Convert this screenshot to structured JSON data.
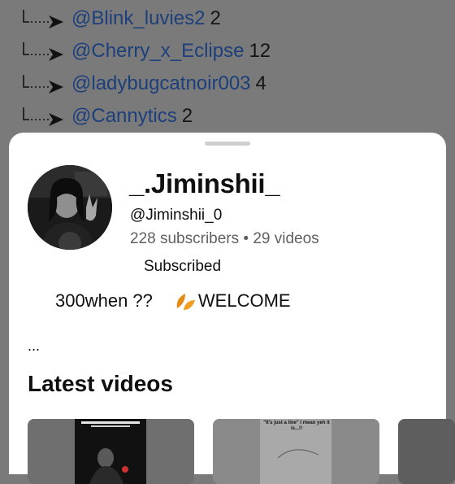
{
  "background_list": [
    {
      "handle": "@Blink_luvies2",
      "count": "2"
    },
    {
      "handle": "@Cherry_x_Eclipse",
      "count": "12"
    },
    {
      "handle": "@ladybugcatnoir003",
      "count": "4"
    },
    {
      "handle": "@Cannytics",
      "count": "2"
    }
  ],
  "channel": {
    "name": "_.Jiminshii_",
    "handle": "@Jiminshii_0",
    "stats": "228 subscribers • 29 videos",
    "subscribe_label": "Subscribed",
    "description_part1": "300when ??",
    "description_part2": "WELCOME",
    "more": "..."
  },
  "latest_videos": {
    "title": "Latest videos",
    "thumb1_caption": "",
    "thumb2_caption": "\"It's just a line\" I mean yeh it is...!!"
  },
  "colors": {
    "overlay": "#7a7a7a",
    "handle_link": "#1d3f7a",
    "sheet": "#ffffff",
    "secondary_text": "#606060"
  },
  "icons": {
    "reply_arrow": "reply-arrow-icon",
    "leaf": "leaf-emoji-icon"
  }
}
